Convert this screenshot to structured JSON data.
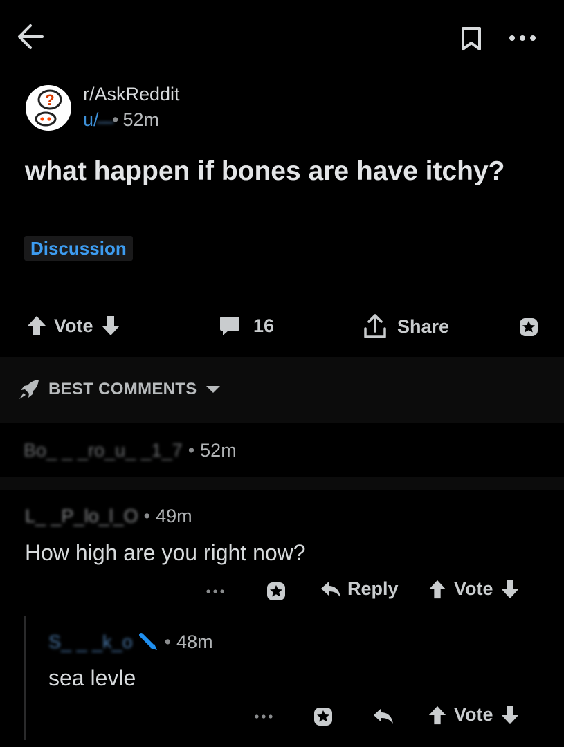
{
  "header": {
    "back_icon": "arrow-left-icon",
    "bookmark_icon": "bookmark-icon",
    "more_icon": "more-dots-icon"
  },
  "post": {
    "subreddit": "r/AskReddit",
    "author_prefix": "u/",
    "author_obscured": "̶̶̶  ̶̶̶",
    "sep": "•",
    "time": "52m",
    "title": "what happen if bones are have itchy?",
    "flair": "Discussion",
    "vote_label": "Vote",
    "comment_count": "16",
    "share_label": "Share"
  },
  "sort": {
    "label": "BEST COMMENTS"
  },
  "comments": [
    {
      "author": "Bo_  _ _ro_u_ _1_7",
      "time": "52m"
    },
    {
      "author": "L_ _P_lo_l_O",
      "time": "49m",
      "body": "How high are you right now?",
      "reply_label": "Reply",
      "vote_label": "Vote"
    },
    {
      "author": "S_ _ _k_o",
      "time": "48m",
      "body": "sea levle",
      "vote_label": "Vote"
    }
  ],
  "colors": {
    "background": "#000000",
    "text": "#d7dadc",
    "flair_text": "#3d9cf0",
    "flair_bg": "#1a1a1b",
    "muted": "#818384"
  }
}
